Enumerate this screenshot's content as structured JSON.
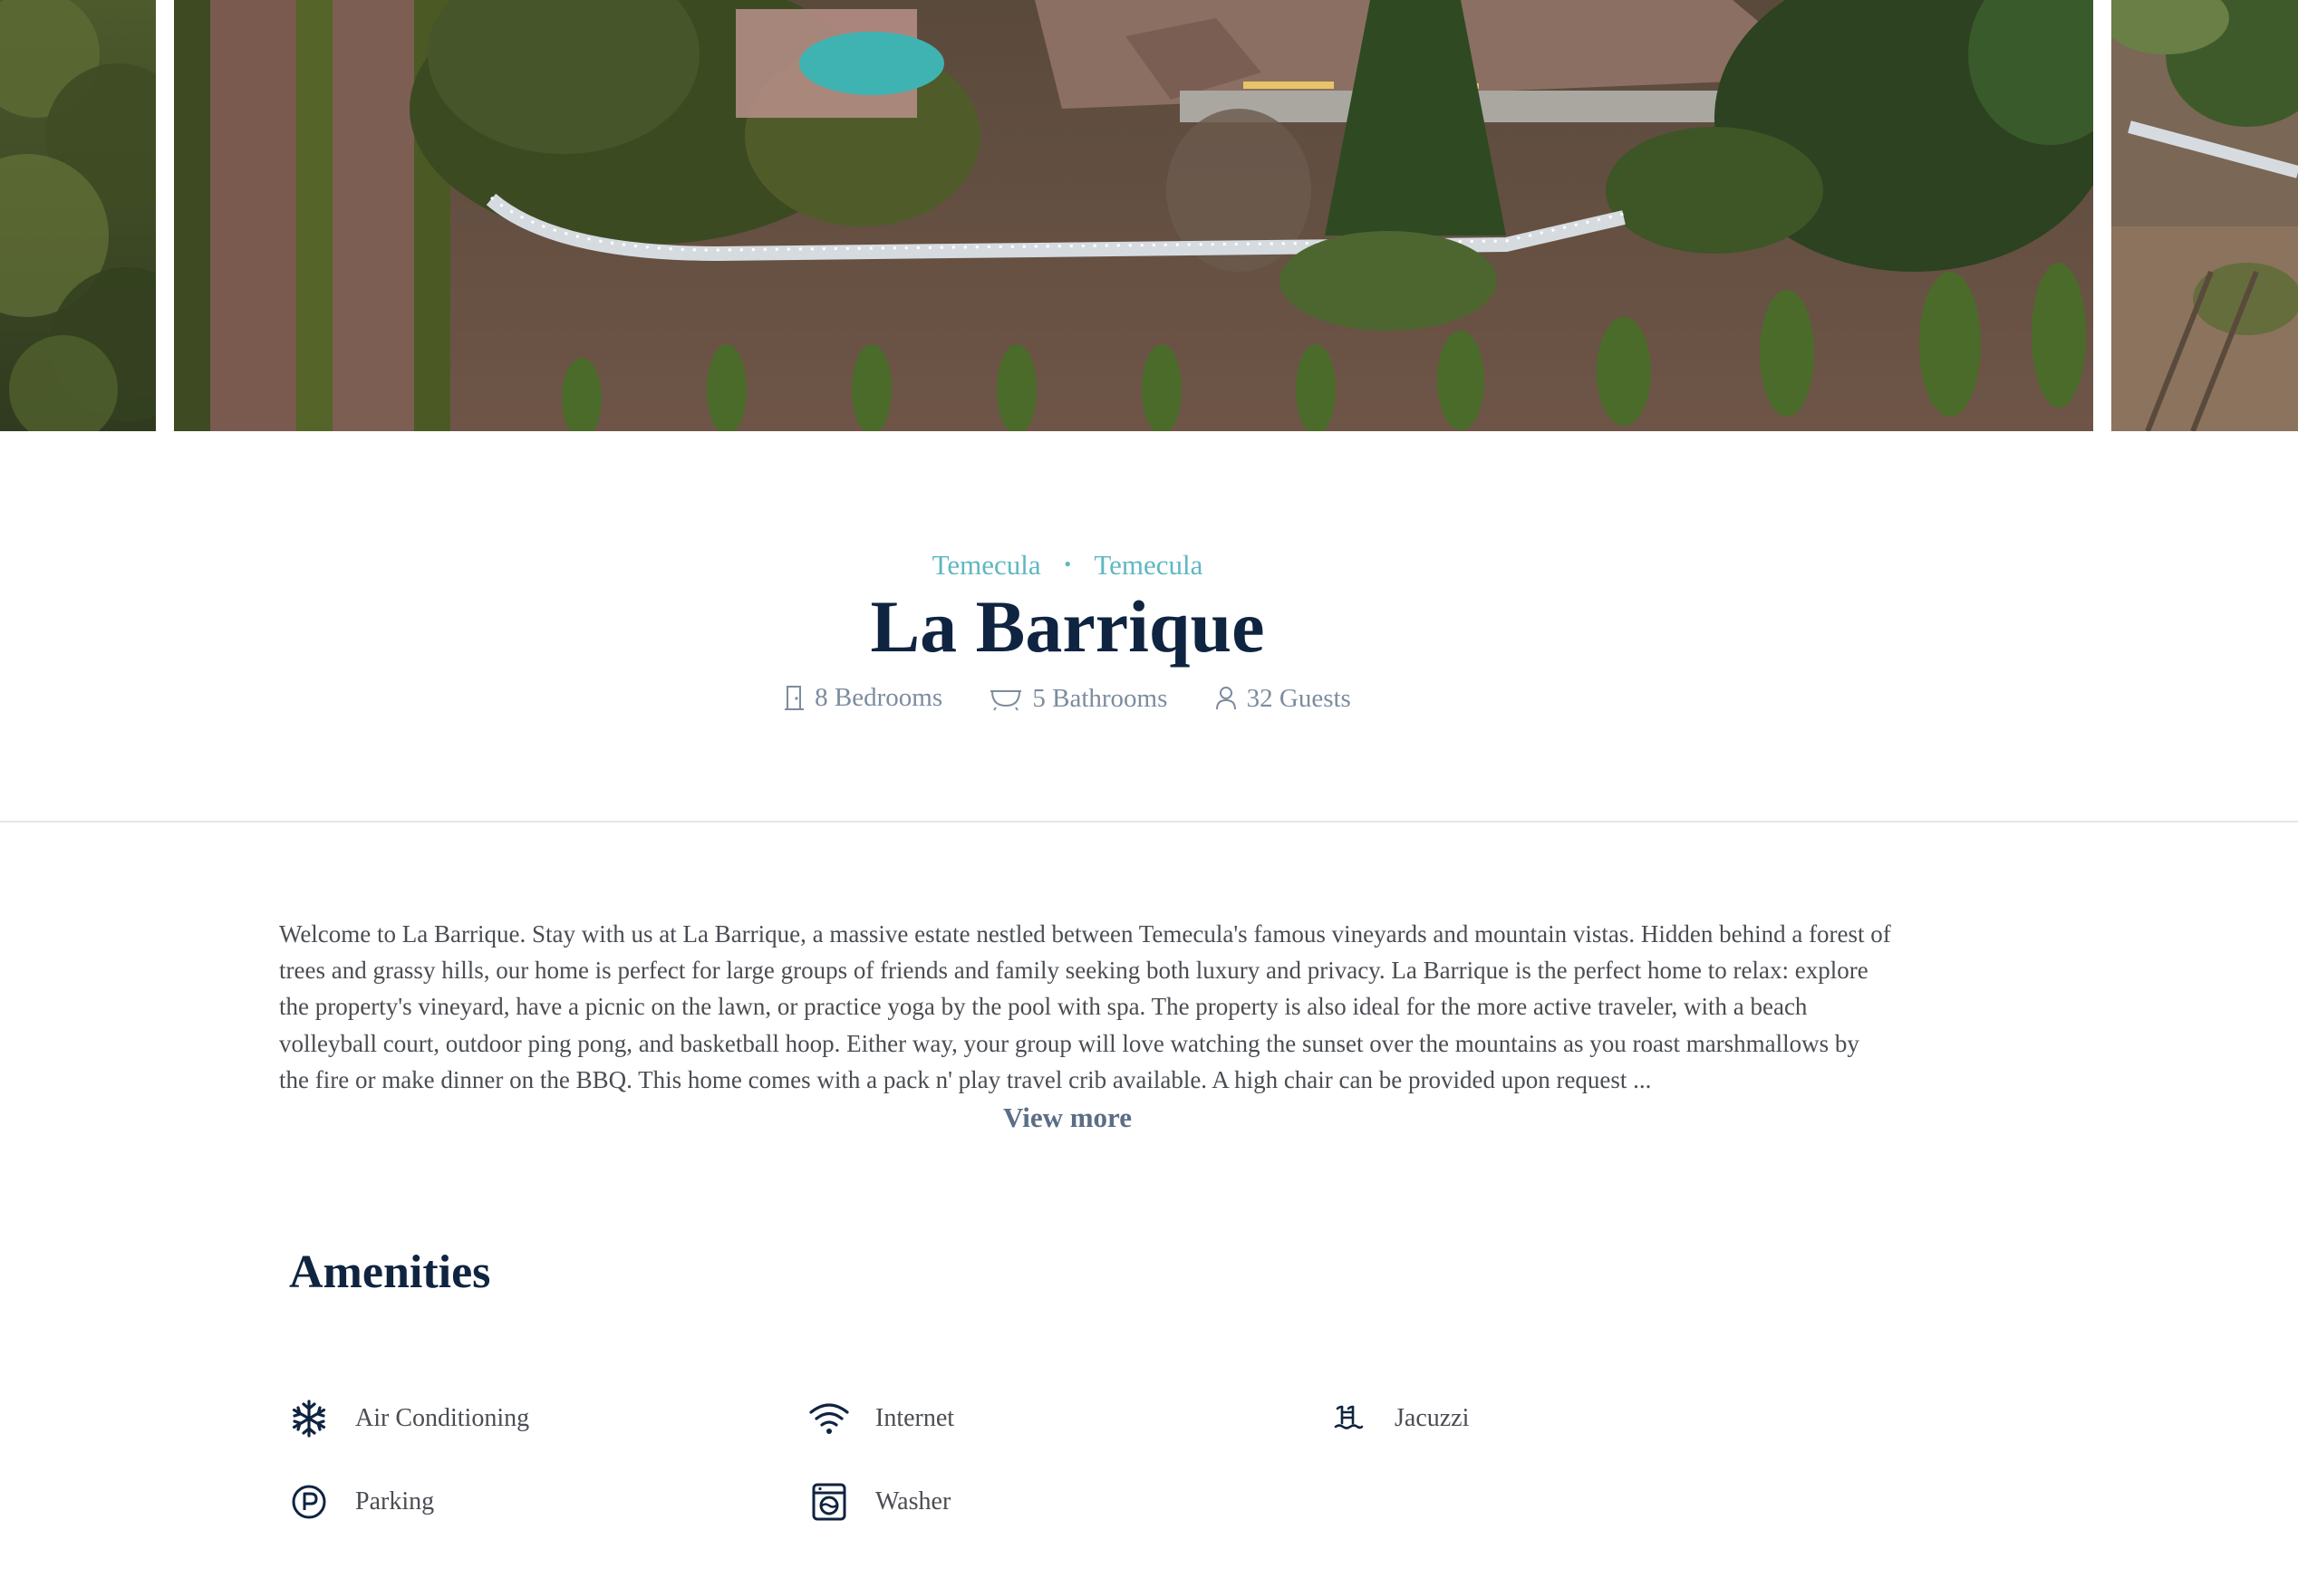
{
  "listing": {
    "location_primary": "Temecula",
    "location_separator": "•",
    "location_secondary": "Temecula",
    "title": "La Barrique",
    "stats": {
      "bedrooms": "8 Bedrooms",
      "bathrooms": "5 Bathrooms",
      "guests": "32 Guests"
    },
    "description": "Welcome to La Barrique. Stay with us at La Barrique, a massive estate nestled between Temecula's famous vineyards and mountain vistas. Hidden behind a forest of trees and grassy hills, our home is perfect for large groups of friends and family seeking both luxury and privacy. La Barrique is the perfect home to relax: explore the property's vineyard, have a picnic on the lawn, or practice yoga by the pool with spa. The property is also ideal for the more active traveler, with a beach volleyball court, outdoor ping pong, and basketball hoop. Either way, your group will love watching the sunset over the mountains as you roast marshmallows by the fire or make dinner on the BBQ. This home comes with a pack n' play travel crib available. A high chair can be provided upon request ...",
    "view_more_label": "View more"
  },
  "amenities": {
    "title": "Amenities",
    "items": [
      {
        "label": "Air Conditioning",
        "icon": "snowflake-icon"
      },
      {
        "label": "Internet",
        "icon": "wifi-icon"
      },
      {
        "label": "Jacuzzi",
        "icon": "jacuzzi-icon"
      },
      {
        "label": "Parking",
        "icon": "parking-icon"
      },
      {
        "label": "Washer",
        "icon": "washer-icon"
      }
    ]
  },
  "colors": {
    "accent_teal": "#5fb7c2",
    "heading_navy": "#0f2440",
    "muted_text": "#7d8c9e",
    "body_text": "#4a4d52",
    "link": "#5b6e86"
  }
}
